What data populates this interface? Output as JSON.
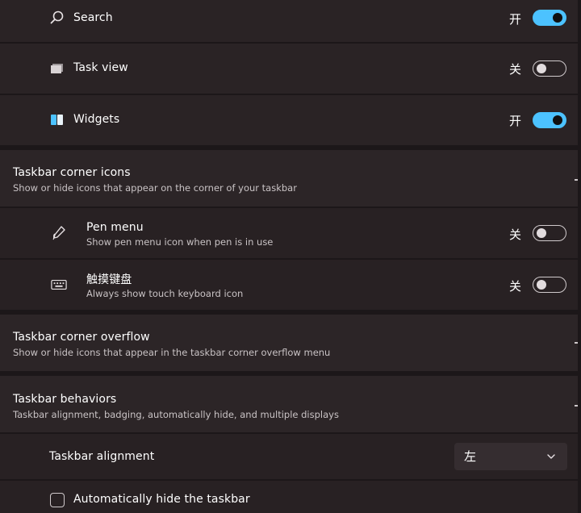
{
  "taskbar_items": {
    "search": {
      "label": "Search",
      "state": "开",
      "on": true,
      "icon": "search-icon"
    },
    "task_view": {
      "label": "Task view",
      "state": "关",
      "on": false,
      "icon": "task-view-icon"
    },
    "widgets": {
      "label": "Widgets",
      "state": "开",
      "on": true,
      "icon": "widgets-icon"
    }
  },
  "corner_icons": {
    "title": "Taskbar corner icons",
    "description": "Show or hide icons that appear on the corner of your taskbar",
    "pen_menu": {
      "label": "Pen menu",
      "description": "Show pen menu icon when pen is in use",
      "state": "关",
      "on": false,
      "icon": "pen-icon"
    },
    "touch_keyboard": {
      "label": "触摸键盘",
      "description": "Always show touch keyboard icon",
      "state": "关",
      "on": false,
      "icon": "keyboard-icon"
    }
  },
  "corner_overflow": {
    "title": "Taskbar corner overflow",
    "description": "Show or hide icons that appear in the taskbar corner overflow menu"
  },
  "behaviors": {
    "title": "Taskbar behaviors",
    "description": "Taskbar alignment, badging, automatically hide, and multiple displays",
    "alignment": {
      "label": "Taskbar alignment",
      "value": "左"
    },
    "auto_hide": {
      "label": "Automatically hide the taskbar",
      "checked": false
    }
  },
  "colors": {
    "accent": "#4cc2ff",
    "background": "#1c1719",
    "card": "#2a2325"
  }
}
